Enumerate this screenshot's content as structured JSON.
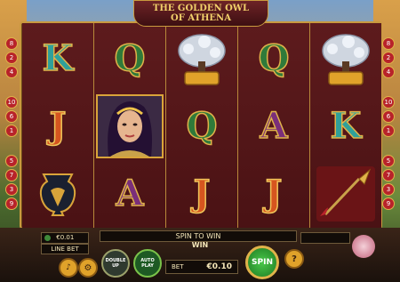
{
  "title": {
    "line1": "THE GOLDEN OWL",
    "line2": "OF ATHENA"
  },
  "paylines_left": [
    "8",
    "2",
    "4",
    "10",
    "6",
    "1",
    "5",
    "7",
    "3",
    "9"
  ],
  "paylines_right": [
    "8",
    "2",
    "4",
    "10",
    "6",
    "1",
    "5",
    "7",
    "3",
    "9"
  ],
  "reels": [
    [
      "K",
      "J",
      "vase"
    ],
    [
      "Q",
      "woman",
      "A"
    ],
    [
      "tree",
      "Q",
      "J"
    ],
    [
      "Q",
      "A",
      "J"
    ],
    [
      "tree",
      "K",
      "spear"
    ]
  ],
  "controls": {
    "line_bet_value": "€0.01",
    "line_bet_label": "LINE BET",
    "status_text": "SPIN TO WIN",
    "win_label": "WIN",
    "bet_label": "BET",
    "bet_value": "€0.10",
    "double_up_label": "DOUBLE UP",
    "auto_play_label": "AUTO PLAY",
    "spin_label": "SPIN",
    "help_label": "?"
  }
}
